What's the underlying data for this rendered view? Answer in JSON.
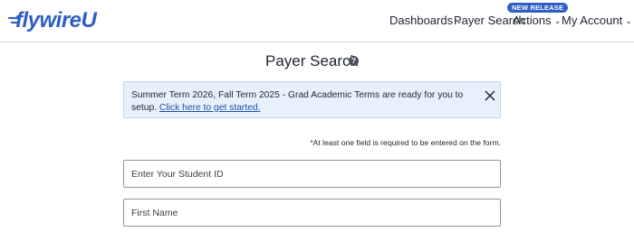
{
  "brand": {
    "logo_text": "flywireU",
    "accent": "#2f5fc4"
  },
  "nav": {
    "dashboards": "Dashboards",
    "payer_search": "Payer Search",
    "actions": "Actions",
    "actions_badge": "NEW RELEASE",
    "my_account": "My Account"
  },
  "page": {
    "title": "Payer Search",
    "help_glyph": "?"
  },
  "banner": {
    "text": "Summer Term 2026, Fall Term 2025 - Grad Academic Terms are ready for you to setup. ",
    "link": "Click here to get started."
  },
  "form": {
    "required_note": "*At least one field is required to be entered on the form.",
    "student_id_placeholder": "Enter Your Student ID",
    "first_name_placeholder": "First Name"
  }
}
